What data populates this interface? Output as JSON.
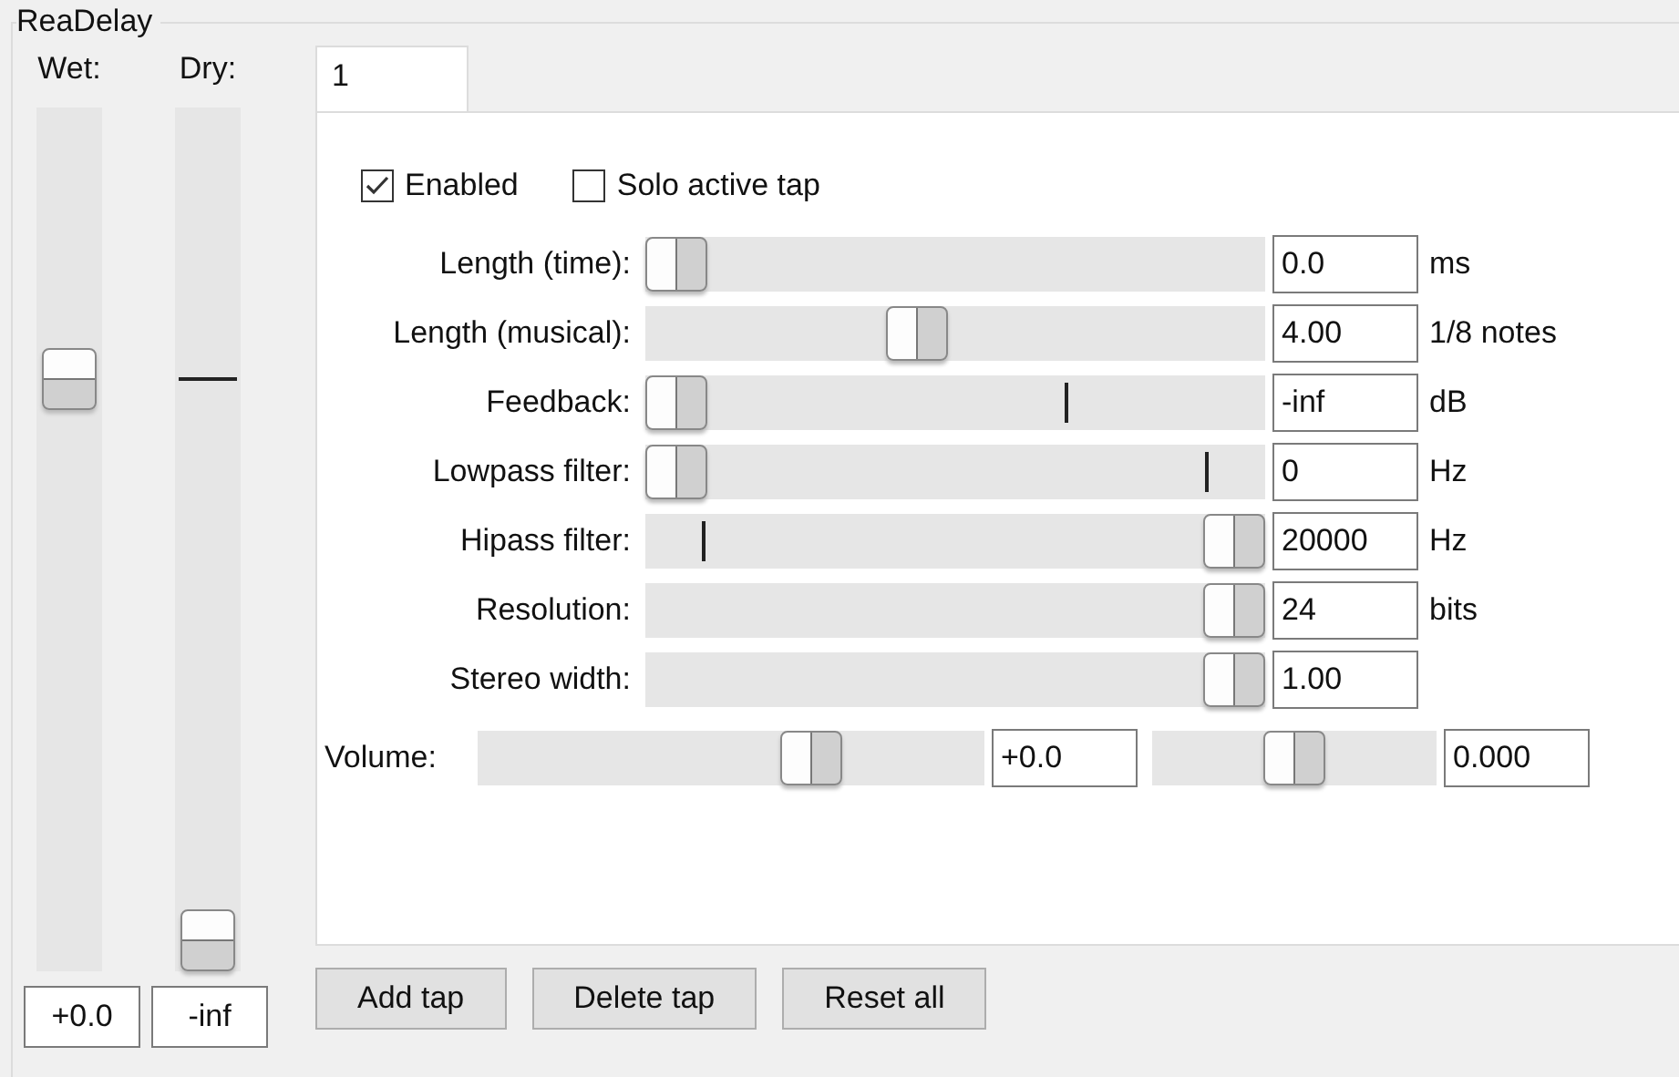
{
  "group": {
    "title": "ReaDelay"
  },
  "mix": [
    {
      "label": "Wet:",
      "level": 0.7,
      "value": "+0.0"
    },
    {
      "label": "Dry:",
      "level": 0,
      "marker": {
        "level": 0.7
      },
      "value": "-inf"
    }
  ],
  "tabs": [
    {
      "label": "1",
      "selected": true
    }
  ],
  "options": [
    {
      "label": "Enabled",
      "checked": true
    },
    {
      "label": "Solo active tap",
      "checked": false
    }
  ],
  "params": [
    {
      "label": "Length (time):",
      "level": 0,
      "value": "0.0",
      "unit": "ms"
    },
    {
      "label": "Length (musical):",
      "level": 0.43,
      "value": "4.00",
      "unit": "1/8 notes"
    },
    {
      "label": "Feedback:",
      "level": 0,
      "marker": {
        "level": 0.7
      },
      "value": "-inf",
      "unit": "dB"
    },
    {
      "label": "Lowpass filter:",
      "level": 0,
      "marker": {
        "level": 0.95
      },
      "value": "0",
      "unit": "Hz"
    },
    {
      "label": "Hipass filter:",
      "level": 1,
      "marker": {
        "level": 0.05
      },
      "value": "20000",
      "unit": "Hz"
    },
    {
      "label": "Resolution:",
      "level": 1,
      "value": "24",
      "unit": "bits"
    },
    {
      "label": "Stereo width:",
      "level": 1,
      "value": "1.00"
    }
  ],
  "volume": {
    "label": "Volume:",
    "level": 0.68,
    "value": "+0.0",
    "pan": {
      "level": 0.5,
      "value": "0.000"
    }
  },
  "buttons": [
    "Add tap",
    "Delete tap",
    "Reset all"
  ]
}
